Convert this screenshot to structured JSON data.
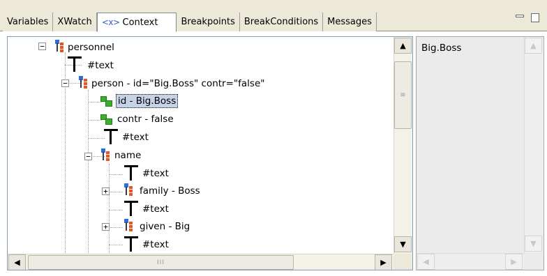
{
  "tabs": [
    {
      "label": "Variables"
    },
    {
      "label": "XWatch"
    },
    {
      "label": "Context",
      "icon": "<x>"
    },
    {
      "label": "Breakpoints"
    },
    {
      "label": "BreakConditions"
    },
    {
      "label": "Messages"
    }
  ],
  "active_tab": "Context",
  "tree": [
    {
      "label": "personnel"
    },
    {
      "label": "#text"
    },
    {
      "label": "person - id=\"Big.Boss\" contr=\"false\""
    },
    {
      "label": "id - Big.Boss",
      "selected": true
    },
    {
      "label": "contr - false"
    },
    {
      "label": "#text"
    },
    {
      "label": "name"
    },
    {
      "label": "#text"
    },
    {
      "label": "family - Boss"
    },
    {
      "label": "#text"
    },
    {
      "label": "given - Big"
    },
    {
      "label": "#text"
    }
  ],
  "value_panel": {
    "text": "Big.Boss"
  },
  "scroll": {
    "up_arrow": "▲",
    "down_arrow": "▼",
    "left_arrow": "◀",
    "right_arrow": "▶",
    "v_grip": "≡",
    "h_grip": "III"
  },
  "expanders": {
    "collapse": "−",
    "expand": "+"
  }
}
